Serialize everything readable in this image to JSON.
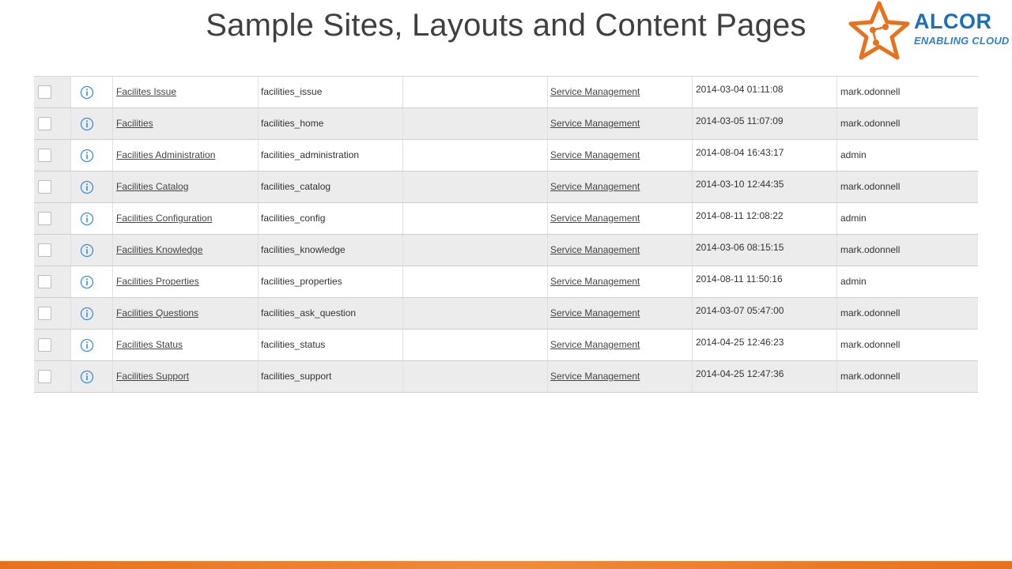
{
  "slide": {
    "title": "Sample Sites, Layouts and Content Pages"
  },
  "logo": {
    "name": "ALCOR",
    "tagline": "ENABLING CLOUD",
    "colors": {
      "orange": "#e8711c",
      "blue": "#1f6fb8"
    }
  },
  "table": {
    "rows": [
      {
        "name": "Facilites Issue",
        "id": "facilities_issue",
        "application": "Service Management",
        "updated": "2014-03-04 01:11:08",
        "updated_by": "mark.odonnell"
      },
      {
        "name": "Facilities",
        "id": "facilities_home",
        "application": "Service Management",
        "updated": "2014-03-05 11:07:09",
        "updated_by": "mark.odonnell"
      },
      {
        "name": "Facilities Administration",
        "id": "facilities_administration",
        "application": "Service Management",
        "updated": "2014-08-04 16:43:17",
        "updated_by": "admin"
      },
      {
        "name": "Facilities Catalog",
        "id": "facilities_catalog",
        "application": "Service Management",
        "updated": "2014-03-10 12:44:35",
        "updated_by": "mark.odonnell"
      },
      {
        "name": "Facilities Configuration",
        "id": "facilities_config",
        "application": "Service Management",
        "updated": "2014-08-11 12:08:22",
        "updated_by": "admin"
      },
      {
        "name": "Facilities Knowledge",
        "id": "facilities_knowledge",
        "application": "Service Management",
        "updated": "2014-03-06 08:15:15",
        "updated_by": "mark.odonnell"
      },
      {
        "name": "Facilities Properties",
        "id": "facilities_properties",
        "application": "Service Management",
        "updated": "2014-08-11 11:50:16",
        "updated_by": "admin"
      },
      {
        "name": "Facilities Questions",
        "id": "facilities_ask_question",
        "application": "Service Management",
        "updated": "2014-03-07 05:47:00",
        "updated_by": "mark.odonnell"
      },
      {
        "name": "Facilities Status",
        "id": "facilities_status",
        "application": "Service Management",
        "updated": "2014-04-25 12:46:23",
        "updated_by": "mark.odonnell"
      },
      {
        "name": "Facilities Support",
        "id": "facilities_support",
        "application": "Service Management",
        "updated": "2014-04-25 12:47:36",
        "updated_by": "mark.odonnell"
      }
    ]
  },
  "icons": {
    "row_info": "info-icon",
    "row_select": "checkbox"
  },
  "footer": {
    "bar_color": "#e8711c"
  }
}
